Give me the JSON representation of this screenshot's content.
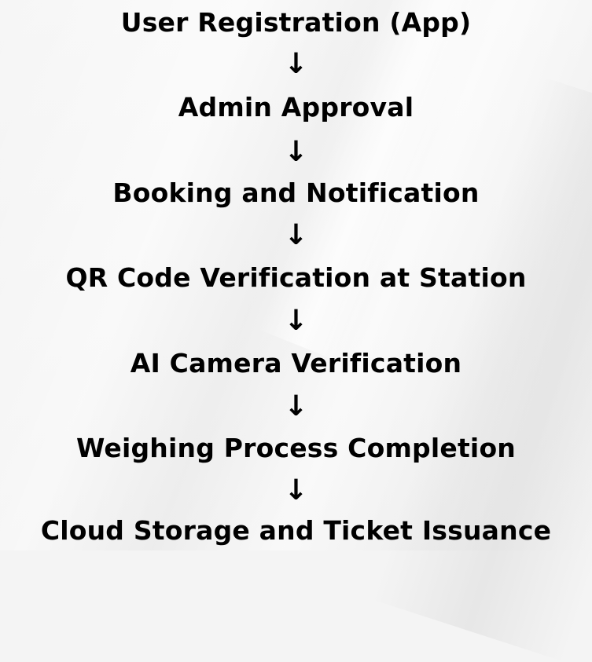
{
  "steps": [
    "User Registration (App)",
    "Admin Approval",
    "Booking and Notification",
    "QR Code Verification at Station",
    "AI Camera Verification",
    "Weighing Process Completion",
    "Cloud Storage and Ticket Issuance"
  ],
  "arrow": "↓"
}
